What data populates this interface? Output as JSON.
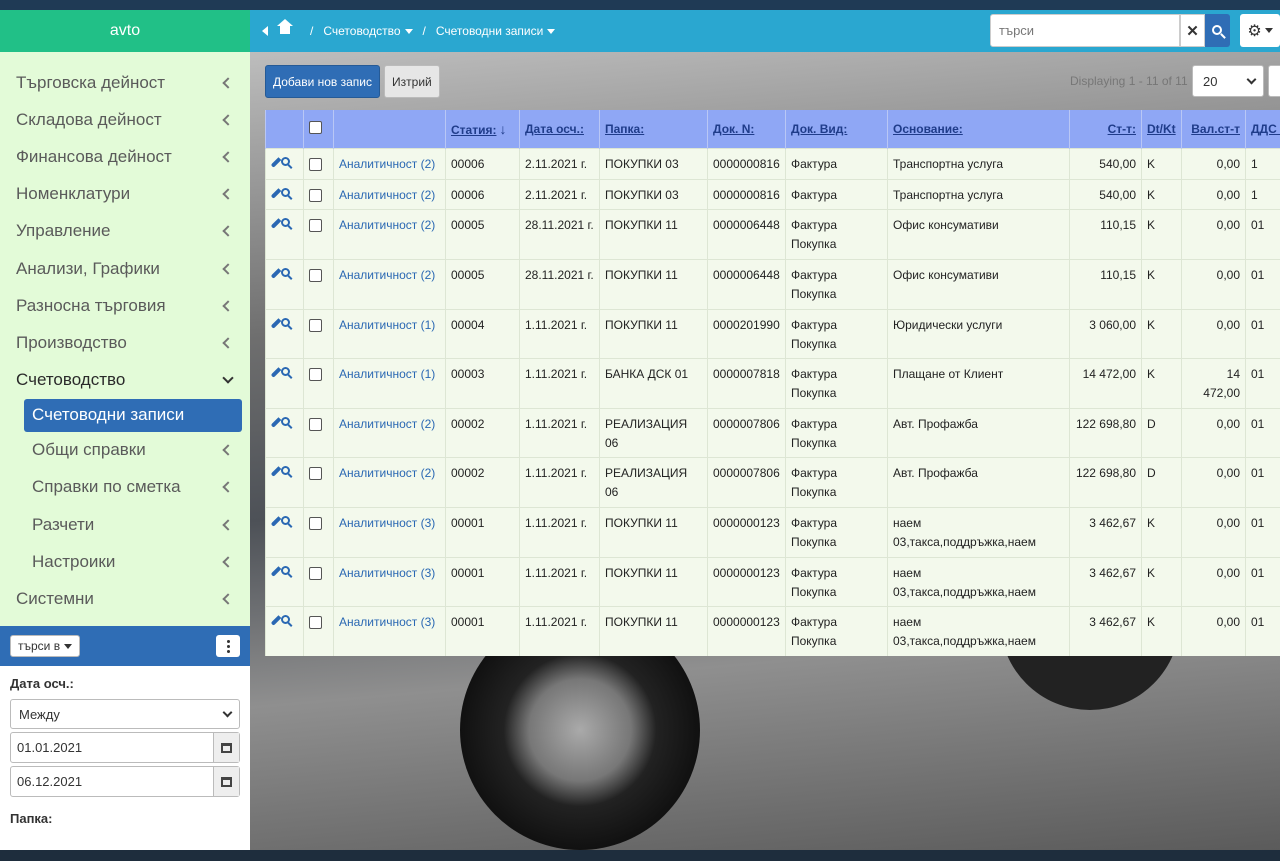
{
  "brand": "avto",
  "sidebar": {
    "items": [
      {
        "label": "Търговска дейност"
      },
      {
        "label": "Складова дейност"
      },
      {
        "label": "Финансова дейност"
      },
      {
        "label": "Номенклатури"
      },
      {
        "label": "Управление"
      },
      {
        "label": "Анализи, Графики"
      },
      {
        "label": "Разносна търговия"
      },
      {
        "label": "Производство"
      },
      {
        "label": "Счетоводство"
      },
      {
        "label": "Счетоводни записи"
      },
      {
        "label": "Общи справки"
      },
      {
        "label": "Справки по сметка"
      },
      {
        "label": "Разчети"
      },
      {
        "label": "Настроики"
      },
      {
        "label": "Системни"
      }
    ]
  },
  "filter": {
    "search_in_label": "търси в",
    "date_label": "Дата осч.:",
    "mode_value": "Между",
    "date_from": "01.01.2021",
    "date_to": "06.12.2021",
    "folder_label": "Папка:"
  },
  "topbar": {
    "crumb1": "Счетоводство",
    "crumb2": "Счетоводни записи",
    "separator": "/",
    "search_placeholder": "търси"
  },
  "toolbar": {
    "add_label": "Добави нов запис",
    "delete_label": "Изтрий",
    "displaying": "Displaying 1 - 11 of 11",
    "page_size": "20"
  },
  "table": {
    "headers": {
      "article": "Статия:",
      "date": "Дата осч.:",
      "folder": "Папка:",
      "docno": "Док. N:",
      "doctype": "Док. Вид:",
      "basis": "Основание:",
      "amount": "Ст-т:",
      "dtkt": "Dt/Kt",
      "curamount": "Вал.ст-т",
      "vat": "ДДС в"
    },
    "rows": [
      {
        "analytic": "Аналитичност (2)",
        "article": "00006",
        "date": "2.11.2021 г.",
        "folder": "ПОКУПКИ 03",
        "docno": "0000000816",
        "doctype": "Фактура",
        "basis": "Транспортна услуга",
        "amount": "540,00",
        "dtkt": "K",
        "curamount": "0,00",
        "vat": "1"
      },
      {
        "analytic": "Аналитичност (2)",
        "article": "00006",
        "date": "2.11.2021 г.",
        "folder": "ПОКУПКИ 03",
        "docno": "0000000816",
        "doctype": "Фактура",
        "basis": "Транспортна услуга",
        "amount": "540,00",
        "dtkt": "K",
        "curamount": "0,00",
        "vat": "1"
      },
      {
        "analytic": "Аналитичност (2)",
        "article": "00005",
        "date": "28.11.2021 г.",
        "folder": "ПОКУПКИ 11",
        "docno": "0000006448",
        "doctype": "Фактура Покупка",
        "basis": "Офис консумативи",
        "amount": "110,15",
        "dtkt": "K",
        "curamount": "0,00",
        "vat": "01"
      },
      {
        "analytic": "Аналитичност (2)",
        "article": "00005",
        "date": "28.11.2021 г.",
        "folder": "ПОКУПКИ 11",
        "docno": "0000006448",
        "doctype": "Фактура Покупка",
        "basis": "Офис консумативи",
        "amount": "110,15",
        "dtkt": "K",
        "curamount": "0,00",
        "vat": "01"
      },
      {
        "analytic": "Аналитичност (1)",
        "article": "00004",
        "date": "1.11.2021 г.",
        "folder": "ПОКУПКИ 11",
        "docno": "0000201990",
        "doctype": "Фактура Покупка",
        "basis": "Юридически услуги",
        "amount": "3 060,00",
        "dtkt": "K",
        "curamount": "0,00",
        "vat": "01"
      },
      {
        "analytic": "Аналитичност (1)",
        "article": "00003",
        "date": "1.11.2021 г.",
        "folder": "БАНКА ДСК 01",
        "docno": "0000007818",
        "doctype": "Фактура Покупка",
        "basis": "Плащане от Клиент",
        "amount": "14 472,00",
        "dtkt": "K",
        "curamount": "14 472,00",
        "vat": "01"
      },
      {
        "analytic": "Аналитичност (2)",
        "article": "00002",
        "date": "1.11.2021 г.",
        "folder": "РЕАЛИЗАЦИЯ 06",
        "docno": "0000007806",
        "doctype": "Фактура Покупка",
        "basis": "Авт. Профажба",
        "amount": "122 698,80",
        "dtkt": "D",
        "curamount": "0,00",
        "vat": "01"
      },
      {
        "analytic": "Аналитичност (2)",
        "article": "00002",
        "date": "1.11.2021 г.",
        "folder": "РЕАЛИЗАЦИЯ 06",
        "docno": "0000007806",
        "doctype": "Фактура Покупка",
        "basis": "Авт. Профажба",
        "amount": "122 698,80",
        "dtkt": "D",
        "curamount": "0,00",
        "vat": "01"
      },
      {
        "analytic": "Аналитичност (3)",
        "article": "00001",
        "date": "1.11.2021 г.",
        "folder": "ПОКУПКИ 11",
        "docno": "0000000123",
        "doctype": "Фактура Покупка",
        "basis": "наем 03,такса,поддръжка,наем",
        "amount": "3 462,67",
        "dtkt": "K",
        "curamount": "0,00",
        "vat": "01"
      },
      {
        "analytic": "Аналитичност (3)",
        "article": "00001",
        "date": "1.11.2021 г.",
        "folder": "ПОКУПКИ 11",
        "docno": "0000000123",
        "doctype": "Фактура Покупка",
        "basis": "наем 03,такса,поддръжка,наем",
        "amount": "3 462,67",
        "dtkt": "K",
        "curamount": "0,00",
        "vat": "01"
      },
      {
        "analytic": "Аналитичност (3)",
        "article": "00001",
        "date": "1.11.2021 г.",
        "folder": "ПОКУПКИ 11",
        "docno": "0000000123",
        "doctype": "Фактура Покупка",
        "basis": "наем 03,такса,поддръжка,наем",
        "amount": "3 462,67",
        "dtkt": "K",
        "curamount": "0,00",
        "vat": "01"
      }
    ]
  }
}
